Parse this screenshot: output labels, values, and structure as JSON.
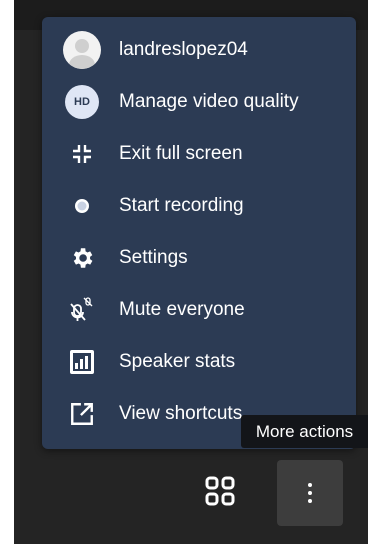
{
  "menu": {
    "items": [
      {
        "label": "landreslopez04",
        "icon": "avatar-icon"
      },
      {
        "label": "Manage video quality",
        "icon": "hd-icon",
        "badge": "HD"
      },
      {
        "label": "Exit full screen",
        "icon": "exit-fullscreen-icon"
      },
      {
        "label": "Start recording",
        "icon": "record-icon"
      },
      {
        "label": "Settings",
        "icon": "gear-icon"
      },
      {
        "label": "Mute everyone",
        "icon": "mute-everyone-icon"
      },
      {
        "label": "Speaker stats",
        "icon": "speaker-stats-icon"
      },
      {
        "label": "View shortcuts",
        "icon": "external-link-icon"
      }
    ]
  },
  "tooltip": {
    "text": "More actions"
  },
  "toolbar": {
    "tile_view_icon": "tile-view-icon",
    "more_icon": "more-vertical-icon"
  },
  "colors": {
    "menu_bg": "#2c3b54",
    "stage_bg": "#242424",
    "tooltip_bg": "#131519"
  }
}
